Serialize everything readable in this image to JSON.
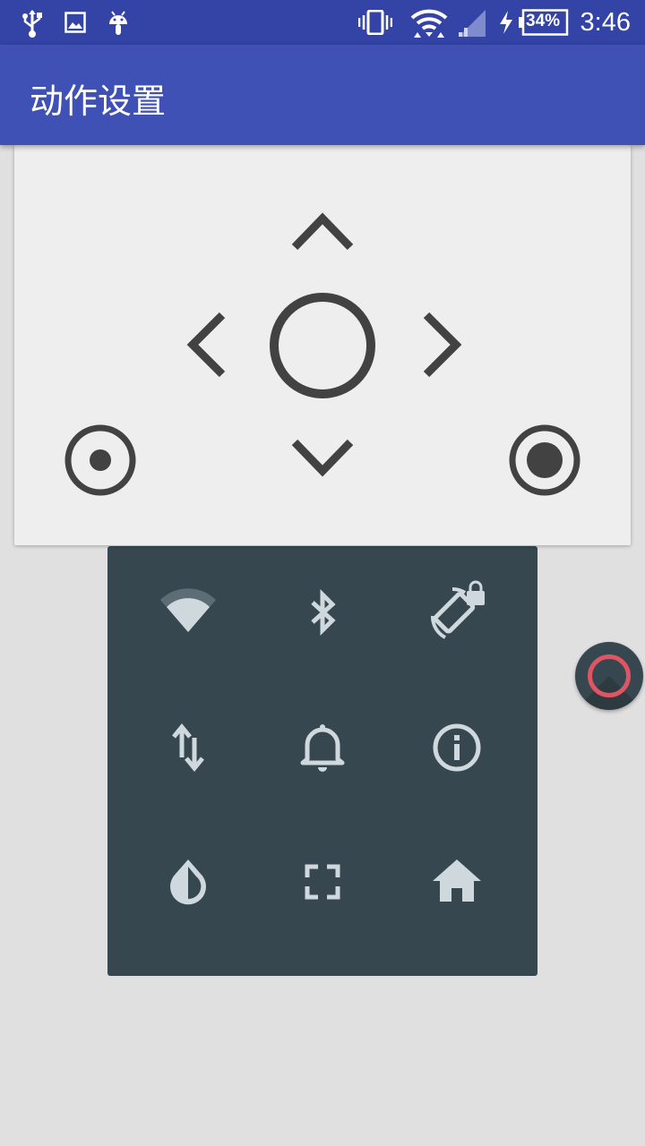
{
  "status_bar": {
    "time": "3:46",
    "battery_percent": "34%",
    "left_icons": [
      "usb-icon",
      "image-icon",
      "android-icon"
    ],
    "right_icons": [
      "vibrate-icon",
      "wifi-icon",
      "signal-icon",
      "charging-icon",
      "battery-icon"
    ]
  },
  "app_bar": {
    "title": "动作设置"
  },
  "dpad": {
    "buttons": [
      "up",
      "left",
      "center",
      "right",
      "down",
      "left-target",
      "right-target"
    ]
  },
  "quick_panel": {
    "tiles": [
      {
        "name": "wifi",
        "icon": "wifi-icon"
      },
      {
        "name": "bluetooth",
        "icon": "bluetooth-icon"
      },
      {
        "name": "rotation-lock",
        "icon": "screen-rotation-lock-icon"
      },
      {
        "name": "mobile-data",
        "icon": "data-arrows-icon"
      },
      {
        "name": "notifications",
        "icon": "bell-icon"
      },
      {
        "name": "info",
        "icon": "info-icon"
      },
      {
        "name": "invert-colors",
        "icon": "invert-colors-icon"
      },
      {
        "name": "fullscreen",
        "icon": "fullscreen-icon"
      },
      {
        "name": "home",
        "icon": "home-icon"
      }
    ]
  },
  "floating_button": {
    "icon": "ring-icon"
  },
  "colors": {
    "status_bar": "#3444a6",
    "app_bar": "#3f51b5",
    "background": "#e0e0e0",
    "card": "#eeeeee",
    "dpad_icons": "#424242",
    "panel": "#37474f",
    "panel_icons": "#cfd8dc",
    "accent_ring": "#e05563"
  }
}
